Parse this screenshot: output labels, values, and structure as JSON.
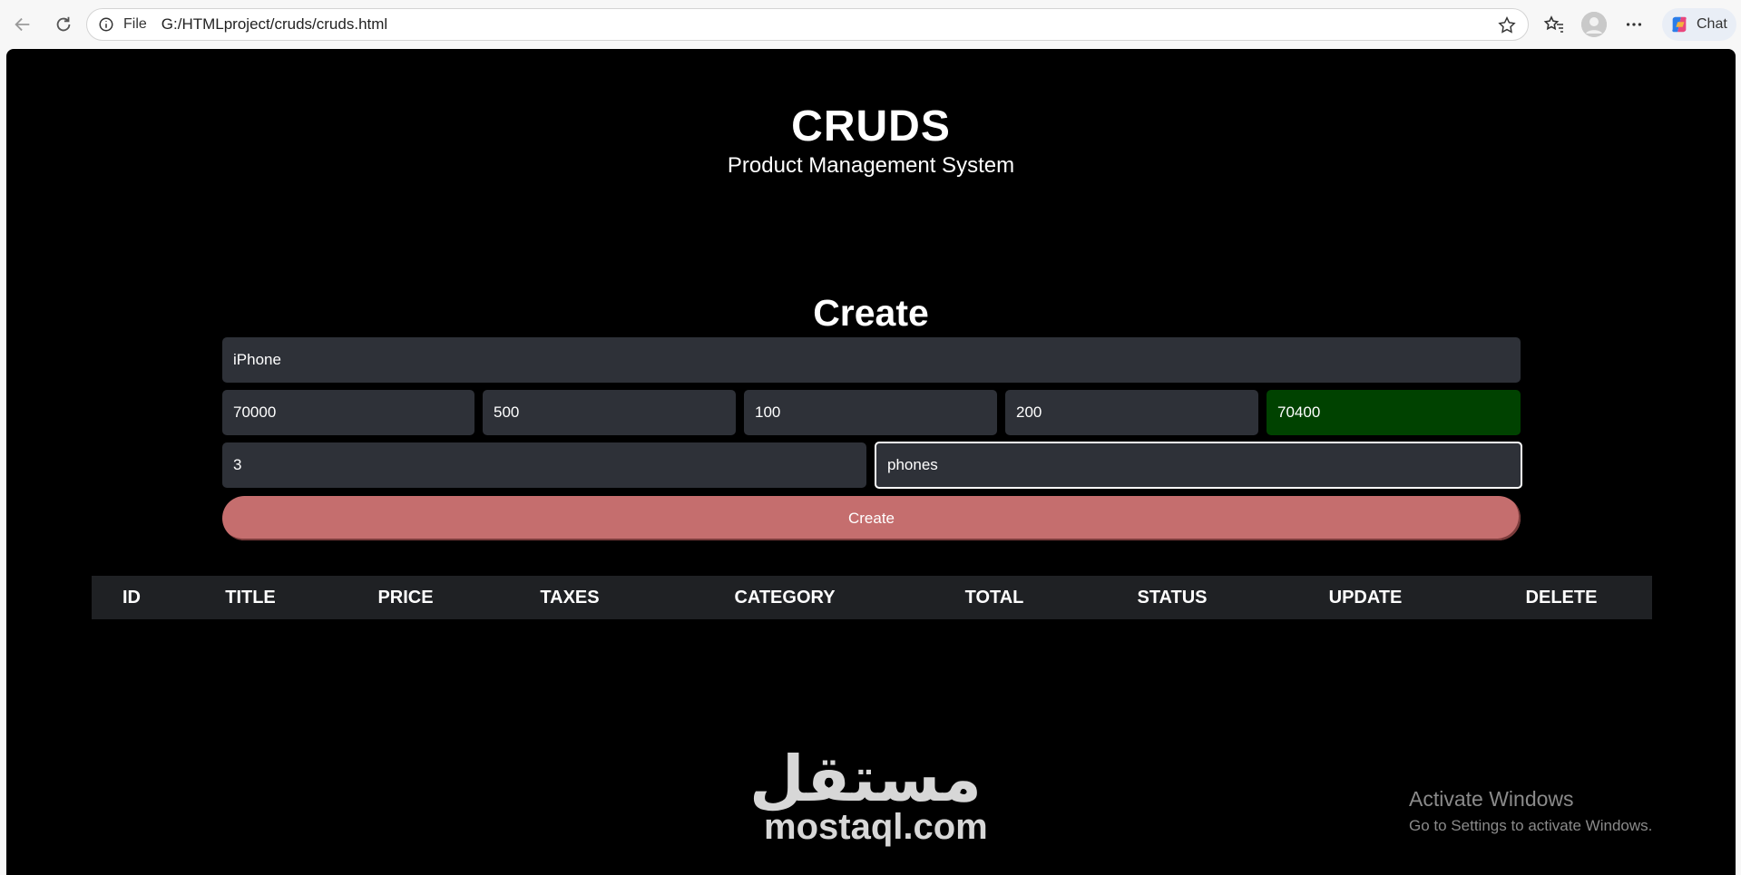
{
  "browser": {
    "scheme_label": "File",
    "url": "G:/HTMLproject/cruds/cruds.html",
    "chat_label": "Chat"
  },
  "header": {
    "title": "CRUDS",
    "subtitle": "Product Management System"
  },
  "form": {
    "section_title": "Create",
    "title_value": "iPhone",
    "price_value": "70000",
    "taxes_value": "500",
    "ads_value": "100",
    "discount_value": "200",
    "total_value": "70400",
    "count_value": "3",
    "category_value": "phones",
    "create_label": "Create",
    "total_color": "#004200",
    "button_color": "#c56e6e"
  },
  "table": {
    "headers": [
      "ID",
      "TITLE",
      "PRICE",
      "TAXES",
      "CATEGORY",
      "TOTAL",
      "STATUS",
      "UPDATE",
      "DELETE"
    ]
  },
  "watermark": {
    "arabic": "مستقل",
    "latin": "mostaql.com"
  },
  "os_notice": {
    "line1": "Activate Windows",
    "line2": "Go to Settings to activate Windows."
  }
}
